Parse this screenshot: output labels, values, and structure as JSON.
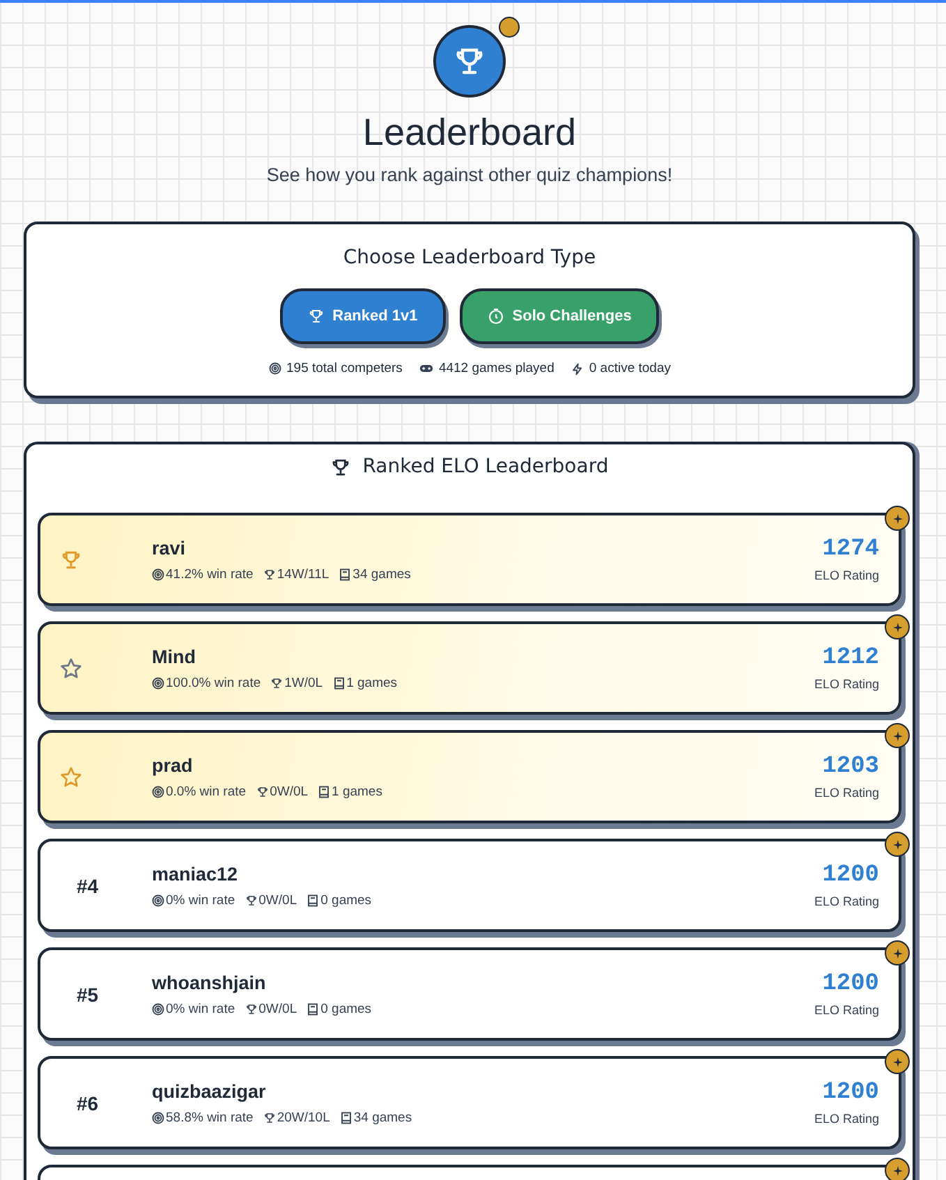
{
  "header": {
    "title": "Leaderboard",
    "subtitle": "See how you rank against other quiz champions!"
  },
  "type_card": {
    "title": "Choose Leaderboard Type",
    "buttons": [
      {
        "label": "Ranked 1v1",
        "kind": "trophy",
        "color": "#2f80d1"
      },
      {
        "label": "Solo Challenges",
        "kind": "clock",
        "color": "#38a169"
      }
    ],
    "stats": [
      {
        "kind": "target",
        "text": "195 total competers"
      },
      {
        "kind": "gamepad",
        "text": "4412 games played"
      },
      {
        "kind": "bolt",
        "text": "0 active today"
      }
    ]
  },
  "board": {
    "title": "Ranked ELO Leaderboard",
    "rows": [
      {
        "kind": "trophy",
        "color": "#e09a2c",
        "name": "ravi",
        "win_rate": "41.2% win rate",
        "record": "14W/11L",
        "games": "34 games",
        "rating": "1274",
        "rating_label": "ELO Rating"
      },
      {
        "kind": "star",
        "color": "#6b7686",
        "name": "Mind",
        "win_rate": "100.0% win rate",
        "record": "1W/0L",
        "games": "1 games",
        "rating": "1212",
        "rating_label": "ELO Rating"
      },
      {
        "kind": "star",
        "color": "#e09a2c",
        "name": "prad",
        "win_rate": "0.0% win rate",
        "record": "0W/0L",
        "games": "1 games",
        "rating": "1203",
        "rating_label": "ELO Rating"
      },
      {
        "kind": "rank",
        "rank": "#4",
        "name": "maniac12",
        "win_rate": "0% win rate",
        "record": "0W/0L",
        "games": "0 games",
        "rating": "1200",
        "rating_label": "ELO Rating"
      },
      {
        "kind": "rank",
        "rank": "#5",
        "name": "whoanshjain",
        "win_rate": "0% win rate",
        "record": "0W/0L",
        "games": "0 games",
        "rating": "1200",
        "rating_label": "ELO Rating"
      },
      {
        "kind": "rank",
        "rank": "#6",
        "name": "quizbaazigar",
        "win_rate": "58.8% win rate",
        "record": "20W/10L",
        "games": "34 games",
        "rating": "1200",
        "rating_label": "ELO Rating"
      },
      {
        "kind": "cut"
      }
    ]
  }
}
